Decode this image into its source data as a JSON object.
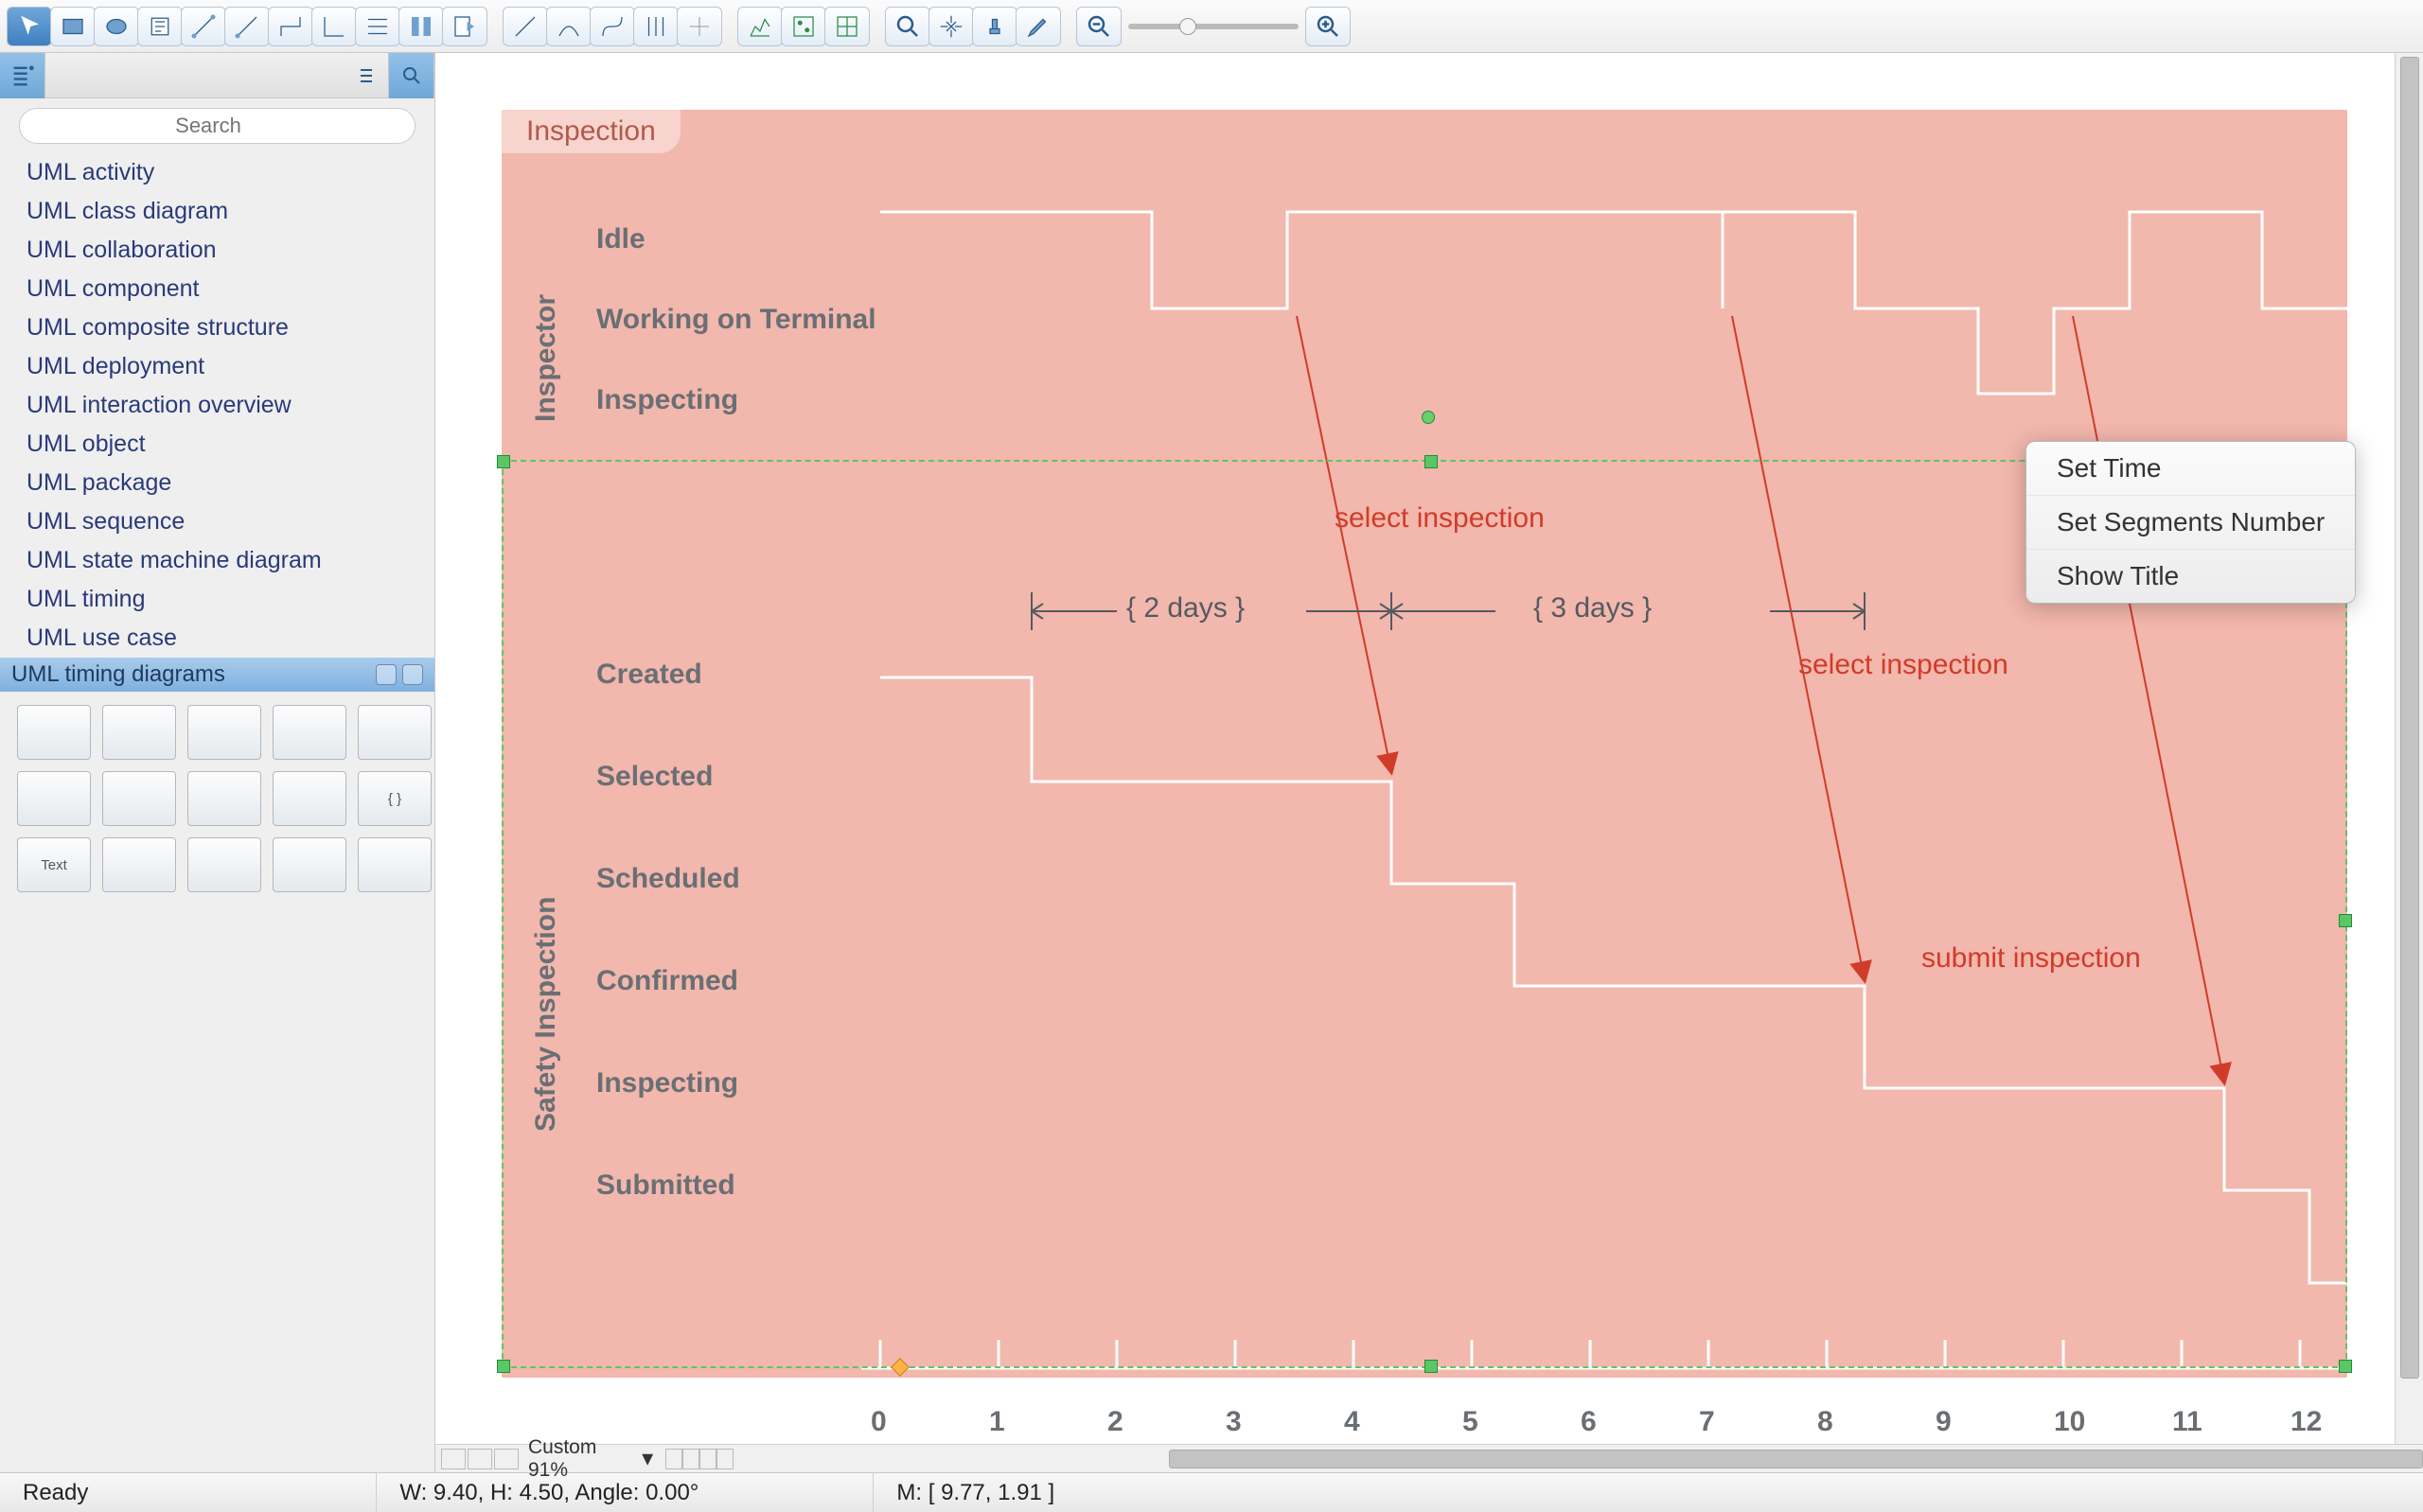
{
  "toolbar": {},
  "sidebar": {
    "search_placeholder": "Search",
    "libraries": [
      "UML activity",
      "UML class diagram",
      "UML collaboration",
      "UML component",
      "UML composite structure",
      "UML deployment",
      "UML interaction overview",
      "UML object",
      "UML package",
      "UML sequence",
      "UML state machine diagram",
      "UML timing",
      "UML use case"
    ],
    "active_palette": "UML timing diagrams",
    "palette_items": [
      "",
      "",
      "",
      "",
      "",
      "",
      "",
      "",
      "",
      "{ }",
      "Text",
      "",
      "",
      "",
      ""
    ]
  },
  "diagram": {
    "title": "Inspection",
    "lane1": {
      "name": "Inspector",
      "states": [
        "Idle",
        "Working on Terminal",
        "Inspecting"
      ]
    },
    "lane2": {
      "name": "Safety Inspection",
      "states": [
        "Created",
        "Selected",
        "Scheduled",
        "Confirmed",
        "Inspecting",
        "Submitted"
      ]
    },
    "ticks": [
      "0",
      "1",
      "2",
      "3",
      "4",
      "5",
      "6",
      "7",
      "8",
      "9",
      "10",
      "11",
      "12"
    ],
    "durations": [
      "{ 2 days }",
      "{ 3 days }"
    ],
    "messages": [
      "select inspection",
      "select inspection",
      "submit inspection"
    ]
  },
  "context_menu": {
    "items": [
      "Set Time",
      "Set Segments Number",
      "Show Title"
    ]
  },
  "status": {
    "ready": "Ready",
    "dims": "W: 9.40,  H: 4.50,  Angle: 0.00°",
    "mouse": "M: [ 9.77, 1.91 ]",
    "zoom_label": "Custom 91%"
  },
  "chart_data": {
    "type": "timing",
    "time_axis": {
      "min": 0,
      "max": 12,
      "ticks": [
        0,
        1,
        2,
        3,
        4,
        5,
        6,
        7,
        8,
        9,
        10,
        11,
        12
      ]
    },
    "lanes": [
      {
        "name": "Inspector",
        "states": [
          "Idle",
          "Working on Terminal",
          "Inspecting"
        ],
        "segments": [
          {
            "state": "Idle",
            "from": 0,
            "to": 2
          },
          {
            "state": "Working on Terminal",
            "from": 2,
            "to": 3.3
          },
          {
            "state": "Idle",
            "from": 3.3,
            "to": 5
          },
          {
            "state": "Inspecting",
            "from": 5,
            "to": 5
          },
          {
            "state": "Idle",
            "from": 5,
            "to": 7
          },
          {
            "state": "Working on Terminal",
            "from": 7,
            "to": 8
          },
          {
            "state": "Inspecting",
            "from": 8,
            "to": 8.5
          },
          {
            "state": "Working on Terminal",
            "from": 8.5,
            "to": 9
          },
          {
            "state": "Idle",
            "from": 9,
            "to": 10
          },
          {
            "state": "Working on Terminal",
            "from": 10,
            "to": 12
          }
        ]
      },
      {
        "name": "Safety Inspection",
        "states": [
          "Created",
          "Selected",
          "Scheduled",
          "Confirmed",
          "Inspecting",
          "Submitted"
        ],
        "segments": [
          {
            "state": "Created",
            "from": 0,
            "to": 1
          },
          {
            "state": "Selected",
            "from": 1,
            "to": 4
          },
          {
            "state": "Scheduled",
            "from": 4,
            "to": 5
          },
          {
            "state": "Confirmed",
            "from": 5,
            "to": 8
          },
          {
            "state": "Inspecting",
            "from": 8,
            "to": 11
          },
          {
            "state": "Submitted",
            "from": 11,
            "to": 12
          }
        ]
      }
    ],
    "duration_constraints": [
      {
        "label": "{ 2 days }",
        "from": 1,
        "to": 4
      },
      {
        "label": "{ 3 days }",
        "from": 4,
        "to": 8
      }
    ],
    "messages": [
      {
        "text": "select inspection",
        "from_lane": "Inspector",
        "to_lane": "Safety Inspection",
        "time": 3.3
      },
      {
        "text": "select inspection",
        "from_lane": "Inspector",
        "to_lane": "Safety Inspection",
        "time": 7
      },
      {
        "text": "submit inspection",
        "from_lane": "Inspector",
        "to_lane": "Safety Inspection",
        "time": 10
      }
    ]
  }
}
